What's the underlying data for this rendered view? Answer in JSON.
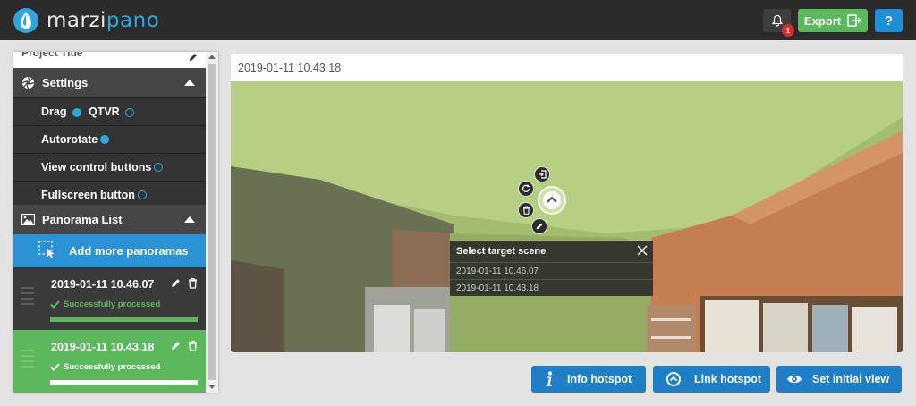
{
  "app": {
    "brand_prefix": "marzi",
    "brand_suffix": "pano",
    "notifications_count": "1",
    "export_label": "Export",
    "help_label": "?"
  },
  "sidebar": {
    "project_title": "Project Title",
    "settings_header": "Settings",
    "options": {
      "drag": {
        "label": "Drag",
        "selected": true
      },
      "qtvr": {
        "label": "QTVR",
        "selected": false
      },
      "autorotate": {
        "label": "Autorotate",
        "enabled": true
      },
      "view_control_buttons": {
        "label": "View control buttons",
        "enabled": false
      },
      "fullscreen_button": {
        "label": "Fullscreen button",
        "enabled": false
      }
    },
    "panorama_list_header": "Panorama List",
    "add_more_label": "Add more panoramas",
    "panoramas": [
      {
        "name": "2019-01-11 10.46.07",
        "status": "Successfully processed",
        "progress": 1.0,
        "active": false
      },
      {
        "name": "2019-01-11 10.43.18",
        "status": "Successfully processed",
        "progress": 1.0,
        "active": true
      }
    ]
  },
  "viewer": {
    "title": "2019-01-11 10.43.18",
    "select_target": {
      "header": "Select target scene",
      "options": [
        "2019-01-11 10.46.07",
        "2019-01-11 10.43.18"
      ]
    }
  },
  "actions": {
    "info_hotspot": "Info hotspot",
    "link_hotspot": "Link hotspot",
    "set_initial_view": "Set initial view"
  },
  "colors": {
    "topbar": "#2b2b2b",
    "accent_blue": "#2fa6dc",
    "button_blue": "#1f7fc6",
    "success_green": "#5cb85c",
    "badge_red": "#e02a2a"
  }
}
